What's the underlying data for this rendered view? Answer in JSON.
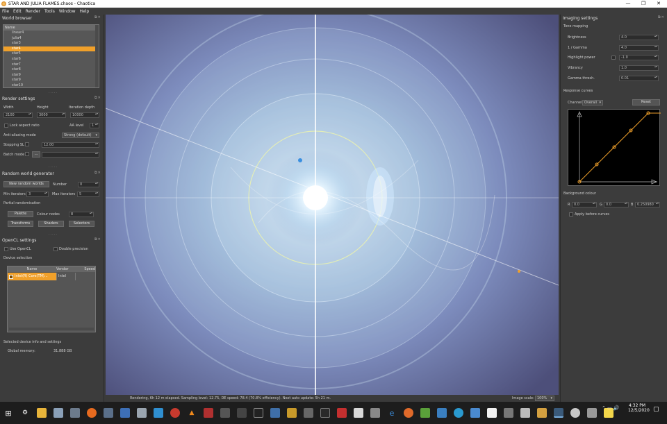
{
  "window": {
    "title": "STAR AND JULIA FLAMES.chaos - Chaotica",
    "controls": [
      "—",
      "❐",
      "✕"
    ]
  },
  "menu": [
    "File",
    "Edit",
    "Render",
    "Tools",
    "Window",
    "Help"
  ],
  "world_browser": {
    "title": "World browser",
    "column": "Name",
    "items": [
      "linear4",
      "julia4",
      "star3",
      "star4",
      "star5",
      "star6",
      "star7",
      "star8",
      "star9",
      "star9",
      "star10"
    ],
    "selected_index": 3
  },
  "render_settings": {
    "title": "Render settings",
    "width_label": "Width",
    "height_label": "Height",
    "iter_label": "Iteration depth",
    "width": "2100",
    "height": "3000",
    "iterations": "10000",
    "lock_aspect": "Lock aspect ratio",
    "aa_label": "AA level",
    "aa_value": "1",
    "aa_mode_label": "Anti-aliasing mode",
    "aa_mode": "Strong (default)",
    "stopping_label": "Stopping SL",
    "stopping_value": "12.00",
    "batch_label": "Batch mode",
    "batch_btn": "..."
  },
  "random_gen": {
    "title": "Random world generator",
    "new_btn": "New random worlds",
    "number_label": "Number",
    "number": "0",
    "min_label": "Min iterators",
    "min": "3",
    "max_label": "Max iterators",
    "max": "5",
    "partial": "Partial randomisation",
    "palette_btn": "Palette",
    "colour_nodes_label": "Colour nodes",
    "colour_nodes": "8",
    "transforms_btn": "Transforms",
    "shaders_btn": "Shaders",
    "selectors_btn": "Selectors"
  },
  "opencl": {
    "title": "OpenCL settings",
    "use_opencl": "Use OpenCL",
    "double_precision": "Double precision",
    "device_selection": "Device selection",
    "columns": [
      "Name",
      "Vendor",
      "Speed"
    ],
    "device_name": "Intel(R) Core(TM)...",
    "device_vendor": "Intel",
    "selected_info": "Selected device info and settings",
    "memory_label": "Global memory:",
    "memory_value": "31.888 GB"
  },
  "imaging": {
    "title": "Imaging settings",
    "tone_mapping": "Tone mapping",
    "brightness_label": "Brightness",
    "brightness": "4.0",
    "gamma_label": "1 / Gamma",
    "gamma": "4.0",
    "highlight_label": "Highlight power",
    "highlight": "-1.0",
    "vibrancy_label": "Vibrancy",
    "vibrancy": "1.0",
    "gamma_thresh_label": "Gamma thresh.",
    "gamma_thresh": "0.01",
    "response_curves": "Response curves",
    "channel_label": "Channel:",
    "channel": "Overall",
    "reset_btn": "Reset",
    "bg_colour": "Background colour",
    "r_label": "R",
    "r": "0.0",
    "g_label": "G",
    "g": "0.0",
    "b_label": "B",
    "b": "0.250980",
    "apply_before": "Apply before curves"
  },
  "status": {
    "text": "Rendering, 6h 12 m elapsed. Sampling level: 12.75, DE speed: 78.4 (70.8% efficiency). Next auto update: 5h 21 m.",
    "scale_label": "Image scale:",
    "scale_value": "100%"
  },
  "clock": {
    "time": "4:32 PM",
    "date": "12/5/2020"
  },
  "colors": {
    "accent": "#f0a02a",
    "panel": "#3c3c3c",
    "taskbar": "#1d1d1d"
  }
}
